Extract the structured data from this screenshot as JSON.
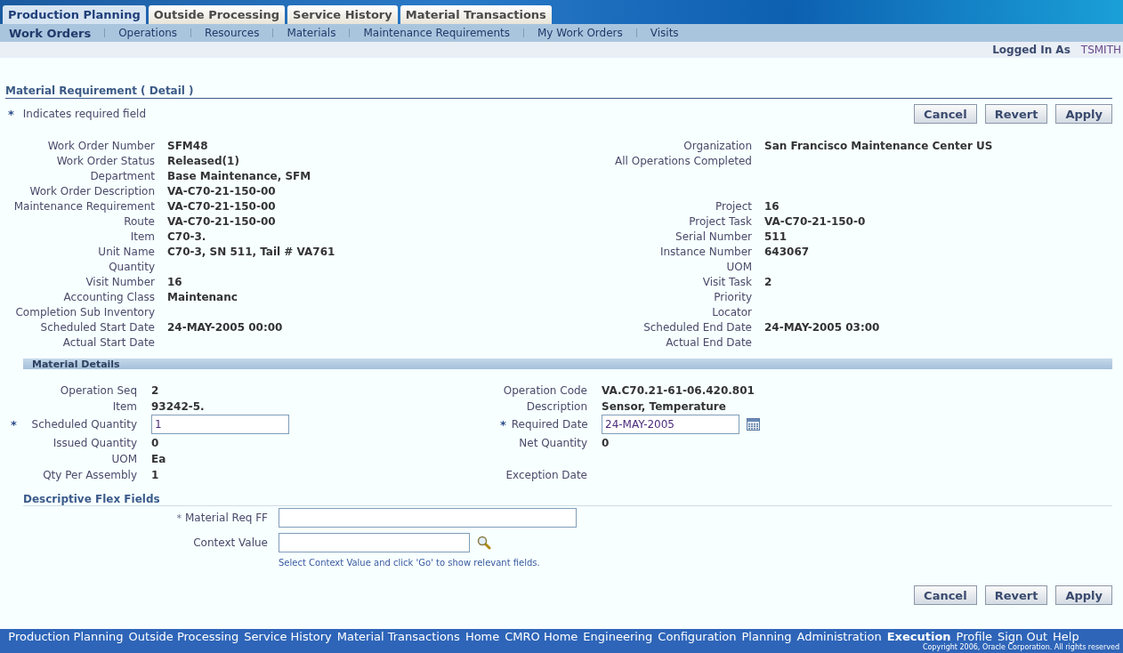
{
  "tabs": [
    {
      "label": "Production Planning",
      "selected": true
    },
    {
      "label": "Outside Processing",
      "selected": false
    },
    {
      "label": "Service History",
      "selected": false
    },
    {
      "label": "Material Transactions",
      "selected": false
    }
  ],
  "subtabs": [
    {
      "label": "Work Orders",
      "selected": true
    },
    {
      "label": "Operations",
      "selected": false
    },
    {
      "label": "Resources",
      "selected": false
    },
    {
      "label": "Materials",
      "selected": false
    },
    {
      "label": "Maintenance Requirements",
      "selected": false
    },
    {
      "label": "My Work Orders",
      "selected": false
    },
    {
      "label": "Visits",
      "selected": false
    }
  ],
  "user": {
    "label": "Logged In As",
    "name": "TSMITH"
  },
  "page_title": "Material Requirement ( Detail )",
  "required_legend": {
    "mark": "*",
    "text": "Indicates required field"
  },
  "top_buttons": [
    "Cancel",
    "Revert",
    "Apply"
  ],
  "header_rows": [
    {
      "left": {
        "label": "Work Order Number",
        "value": "SFM48"
      },
      "right": {
        "label": "Organization",
        "value": "San Francisco Maintenance Center US"
      }
    },
    {
      "left": {
        "label": "Work Order Status",
        "value": "Released(1)"
      },
      "right": {
        "label": "All Operations Completed"
      }
    },
    {
      "left": {
        "label": "Department",
        "value": "Base Maintenance, SFM"
      }
    },
    {
      "left": {
        "label": "Work Order Description",
        "value": "VA-C70-21-150-00"
      }
    },
    {
      "left": {
        "label": "Maintenance Requirement",
        "value": "VA-C70-21-150-00"
      },
      "right": {
        "label": "Project",
        "value": "16"
      }
    },
    {
      "left": {
        "label": "Route",
        "value": "VA-C70-21-150-00"
      },
      "right": {
        "label": "Project Task",
        "value": "VA-C70-21-150-0"
      }
    },
    {
      "left": {
        "label": "Item",
        "value": "C70-3."
      },
      "right": {
        "label": "Serial Number",
        "value": "511"
      }
    },
    {
      "left": {
        "label": "Unit Name",
        "value": "C70-3, SN 511, Tail # VA761"
      },
      "right": {
        "label": "Instance Number",
        "value": "643067"
      }
    },
    {
      "left": {
        "label": "Quantity"
      },
      "right": {
        "label": "UOM"
      }
    },
    {
      "left": {
        "label": "Visit Number",
        "value": "16"
      },
      "right": {
        "label": "Visit Task",
        "value": "2"
      }
    },
    {
      "left": {
        "label": "Accounting Class",
        "value": "Maintenanc"
      },
      "right": {
        "label": "Priority"
      }
    },
    {
      "left": {
        "label": "Completion Sub Inventory"
      },
      "right": {
        "label": "Locator"
      }
    },
    {
      "left": {
        "label": "Scheduled Start Date",
        "value": "24-MAY-2005 00:00"
      },
      "right": {
        "label": "Scheduled End Date",
        "value": "24-MAY-2005 03:00"
      }
    },
    {
      "left": {
        "label": "Actual Start Date"
      },
      "right": {
        "label": "Actual End Date"
      }
    }
  ],
  "material_details": {
    "title": "Material Details",
    "rows": [
      {
        "left": {
          "kind": "text",
          "label": "Operation Seq",
          "value": "2"
        },
        "right": {
          "kind": "text",
          "label": "Operation Code",
          "value": "VA.C70.21-61-06.420.801"
        }
      },
      {
        "left": {
          "kind": "text",
          "label": "Item",
          "value": "93242-5."
        },
        "right": {
          "kind": "text",
          "label": "Description",
          "value": "Sensor, Temperature"
        }
      },
      {
        "left": {
          "kind": "input",
          "mark": "*",
          "label": "Scheduled Quantity",
          "value": "1"
        },
        "right": {
          "kind": "date",
          "mark": "*",
          "label": "Required Date",
          "value": "24-MAY-2005"
        }
      },
      {
        "left": {
          "kind": "text",
          "label": "Issued Quantity",
          "value": "0"
        },
        "right": {
          "kind": "text",
          "label": "Net Quantity",
          "value": "0"
        }
      },
      {
        "left": {
          "kind": "text",
          "label": "UOM",
          "value": "Ea"
        }
      },
      {
        "left": {
          "kind": "text",
          "label": "Qty Per Assembly",
          "value": "1"
        },
        "right": {
          "kind": "text",
          "label": "Exception Date"
        }
      }
    ]
  },
  "flex_fields": {
    "title": "Descriptive Flex Fields",
    "rows": [
      {
        "kind": "input",
        "mark": "*",
        "label": "Material Req FF"
      },
      {
        "kind": "search",
        "label": "Context Value"
      }
    ],
    "hint": "Select Context Value and click 'Go' to show relevant fields."
  },
  "bottom_buttons": [
    "Cancel",
    "Revert",
    "Apply"
  ],
  "footer_links": [
    {
      "label": "Production Planning",
      "selected": false
    },
    {
      "label": "Outside Processing",
      "selected": false
    },
    {
      "label": "Service History",
      "selected": false
    },
    {
      "label": "Material Transactions",
      "selected": false
    },
    {
      "label": "Home",
      "selected": false
    },
    {
      "label": "CMRO Home",
      "selected": false
    },
    {
      "label": "Engineering",
      "selected": false
    },
    {
      "label": "Configuration",
      "selected": false
    },
    {
      "label": "Planning",
      "selected": false
    },
    {
      "label": "Administration",
      "selected": false
    },
    {
      "label": "Execution",
      "selected": true
    },
    {
      "label": "Profile",
      "selected": false
    },
    {
      "label": "Sign Out",
      "selected": false
    },
    {
      "label": "Help",
      "selected": false
    }
  ],
  "copyright": "Copyright 2006, Oracle Corporation. All rights reserved"
}
